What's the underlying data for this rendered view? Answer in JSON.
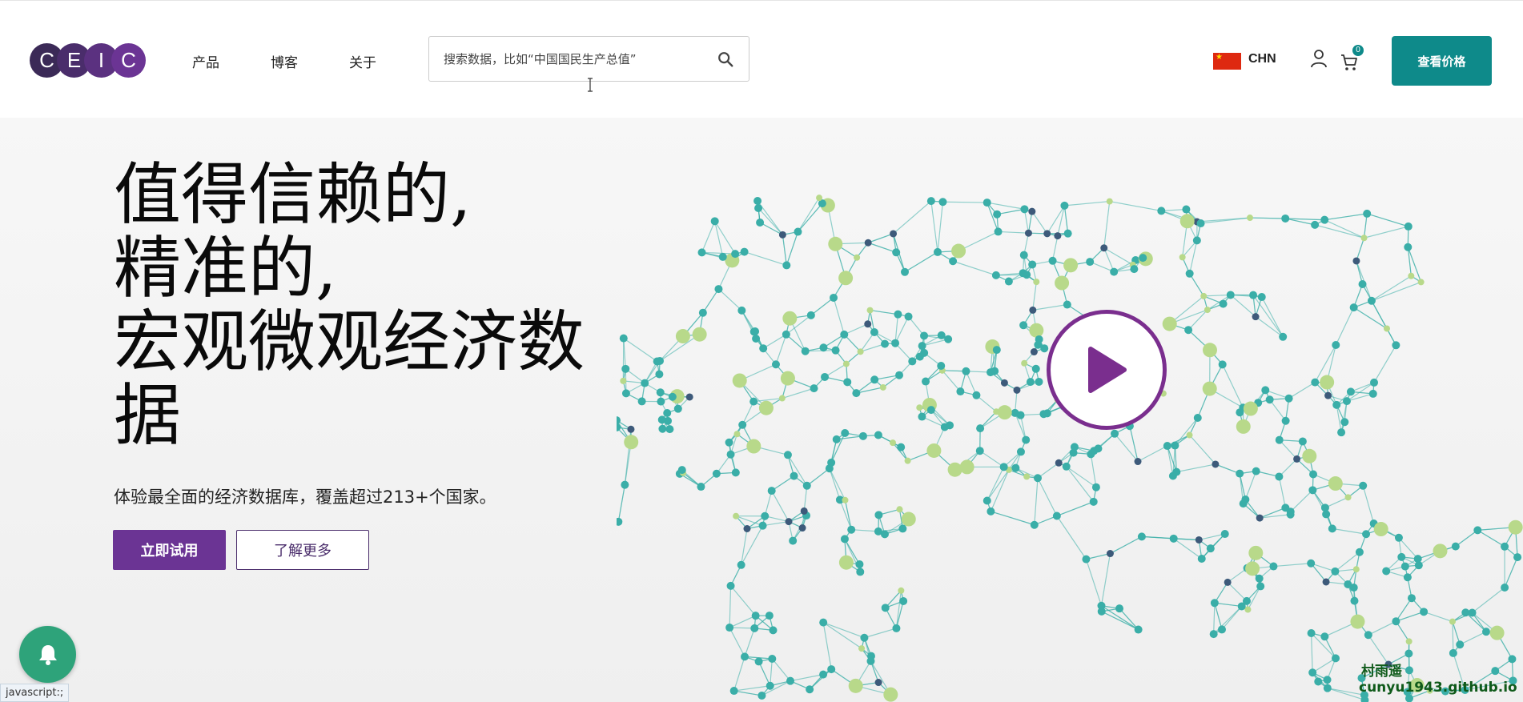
{
  "header": {
    "logo_letters": [
      "C",
      "E",
      "I",
      "C"
    ],
    "nav": {
      "products": "产品",
      "blog": "博客",
      "about": "关于"
    },
    "search": {
      "placeholder": "搜索数据，比如“中国国民生产总值”"
    },
    "country_code": "CHN",
    "cart_count": "0",
    "price_button": "查看价格"
  },
  "hero": {
    "title_lines": [
      "值得信赖的,",
      "精准的,",
      "宏观微观经济数",
      "据"
    ],
    "subtitle": "体验最全面的经济数据库，覆盖超过213+个国家。",
    "primary_button": "立即试用",
    "secondary_button": "了解更多"
  },
  "status_bar": "javascript:;",
  "watermark": {
    "line1": "村雨遥",
    "line2": "cunyu1943.github.io"
  },
  "colors": {
    "brand_purple": "#6b3494",
    "brand_teal": "#0e8a8a",
    "notify_green": "#2ea37a",
    "map_teal": "#3aaea8",
    "map_lime": "#b8d98a",
    "map_navy": "#3d5a7a"
  },
  "icons": [
    "search-icon",
    "user-icon",
    "cart-icon",
    "play-icon",
    "bell-icon",
    "flag-china-icon"
  ]
}
